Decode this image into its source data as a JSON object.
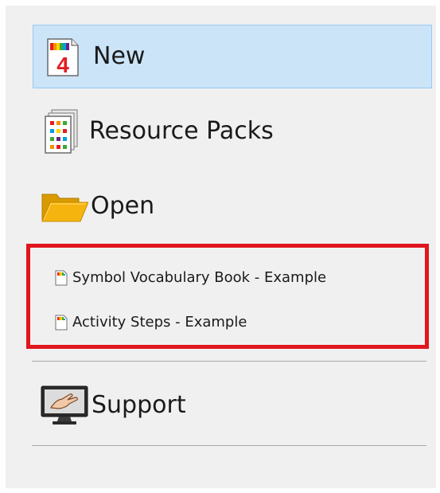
{
  "menu": {
    "new_label": "New",
    "resource_packs_label": "Resource Packs",
    "open_label": "Open",
    "support_label": "Support"
  },
  "recent_files": [
    {
      "label": "Symbol Vocabulary Book - Example",
      "icon": "document-icon"
    },
    {
      "label": "Activity Steps - Example",
      "icon": "document-icon"
    }
  ],
  "colors": {
    "selected_background": "#cce4f7",
    "selected_border": "#99c9ef",
    "highlight_border": "#e0161e",
    "panel_background": "#f0f0f0"
  },
  "icons": {
    "new": "new-document-icon",
    "resource_packs": "resource-packs-icon",
    "open": "folder-icon",
    "support": "support-monitor-icon"
  }
}
